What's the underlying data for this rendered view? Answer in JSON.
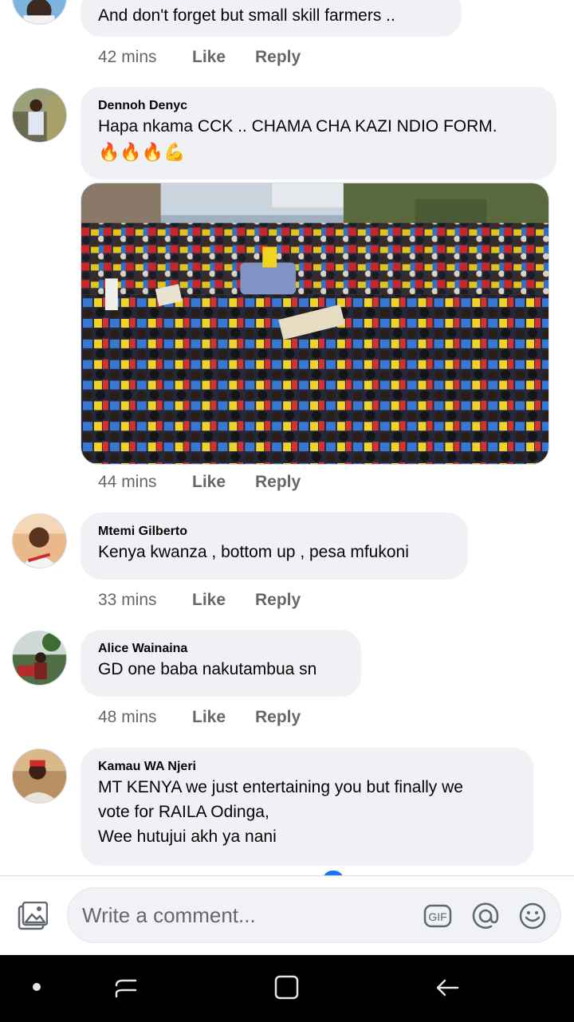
{
  "comments": [
    {
      "author": "",
      "text": "And don't forget but small skill farmers ..",
      "time": "42 mins",
      "like_label": "Like",
      "reply_label": "Reply"
    },
    {
      "author": "Dennoh Denyc",
      "text": "Hapa nkama CCK .. CHAMA CHA KAZI NDIO FORM.",
      "emoji": "🔥🔥🔥💪",
      "time": "44 mins",
      "like_label": "Like",
      "reply_label": "Reply"
    },
    {
      "author": "Mtemi Gilberto",
      "text": "Kenya kwanza , bottom up , pesa mfukoni",
      "time": "33 mins",
      "like_label": "Like",
      "reply_label": "Reply"
    },
    {
      "author": "Alice Wainaina",
      "text": "GD one baba nakutambua sn",
      "time": "48 mins",
      "like_label": "Like",
      "reply_label": "Reply"
    },
    {
      "author": "Kamau WA Njeri",
      "text": "MT KENYA we just entertaining you but finally we\nvote for RAILA Odinga,\nWee hutujui akh ya nani"
    }
  ],
  "composer": {
    "placeholder": "Write a comment...",
    "gif_label": "GIF"
  },
  "colors": {
    "bubble_bg": "#eff1f4",
    "meta_text": "#65676b",
    "accent": "#1877f2"
  }
}
